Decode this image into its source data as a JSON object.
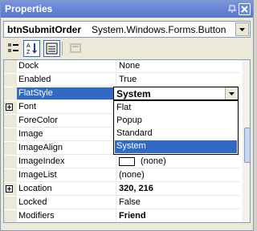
{
  "window": {
    "title": "Properties"
  },
  "object_selector": {
    "name": "btnSubmitOrder",
    "type": "System.Windows.Forms.Button"
  },
  "toolbar": {
    "buttons": [
      {
        "icon": "categorized-icon",
        "pressed": false
      },
      {
        "icon": "alphabetical-icon",
        "pressed": true
      },
      {
        "icon": "properties-icon",
        "pressed": true
      },
      {
        "icon": "property-pages-icon",
        "pressed": false
      }
    ]
  },
  "properties": [
    {
      "name": "Dock",
      "value": "None",
      "expandable": false,
      "bold": false
    },
    {
      "name": "Enabled",
      "value": "True",
      "expandable": false,
      "bold": false
    },
    {
      "name": "FlatStyle",
      "value": "System",
      "expandable": false,
      "bold": true,
      "selected": true
    },
    {
      "name": "Font",
      "value": "",
      "expandable": true,
      "bold": false
    },
    {
      "name": "ForeColor",
      "value": "",
      "expandable": false,
      "bold": false
    },
    {
      "name": "Image",
      "value": "",
      "expandable": false,
      "bold": false
    },
    {
      "name": "ImageAlign",
      "value": "",
      "expandable": false,
      "bold": false
    },
    {
      "name": "ImageIndex",
      "value": "(none)",
      "expandable": false,
      "bold": false,
      "swatch": true
    },
    {
      "name": "ImageList",
      "value": "(none)",
      "expandable": false,
      "bold": false
    },
    {
      "name": "Location",
      "value": "320, 216",
      "expandable": true,
      "bold": true
    },
    {
      "name": "Locked",
      "value": "False",
      "expandable": false,
      "bold": false
    },
    {
      "name": "Modifiers",
      "value": "Friend",
      "expandable": false,
      "bold": true
    }
  ],
  "dropdown": {
    "current": "System",
    "options": [
      "Flat",
      "Popup",
      "Standard",
      "System"
    ],
    "selected_index": 3
  },
  "colors": {
    "selection": "#316ac5",
    "titlebar": "#6a86d6"
  }
}
